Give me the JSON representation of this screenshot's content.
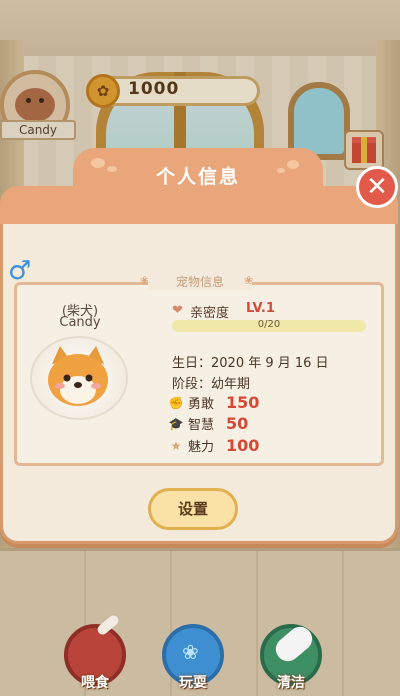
{
  "hud": {
    "player_name": "Candy",
    "coins": "1000"
  },
  "dialog": {
    "title": "个人信息",
    "section_title": "宠物信息",
    "gender_symbol": "♂",
    "pet": {
      "breed": "(柴犬)",
      "name": "Candy"
    },
    "intimacy": {
      "label": "亲密度",
      "level": "LV.1",
      "progress_text": "0/20",
      "progress_fraction": 0.0
    },
    "birthday_line": "生日：2020 年 9 月 16 日",
    "stage_line": "阶段：幼年期",
    "stats": [
      {
        "label": "勇敢",
        "value": "150",
        "icon": "brave-icon"
      },
      {
        "label": "智慧",
        "value": "50",
        "icon": "wisdom-icon"
      },
      {
        "label": "魅力",
        "value": "100",
        "icon": "star-icon"
      }
    ],
    "settings_label": "设置"
  },
  "actions": [
    {
      "label": "喂食",
      "icon": "food-bowl-icon"
    },
    {
      "label": "玩耍",
      "icon": "frisbee-icon"
    },
    {
      "label": "清洁",
      "icon": "brush-icon"
    }
  ],
  "colors": {
    "accent": "#e8a67a",
    "stat_value": "#d54836",
    "close": "#e25a4a"
  }
}
